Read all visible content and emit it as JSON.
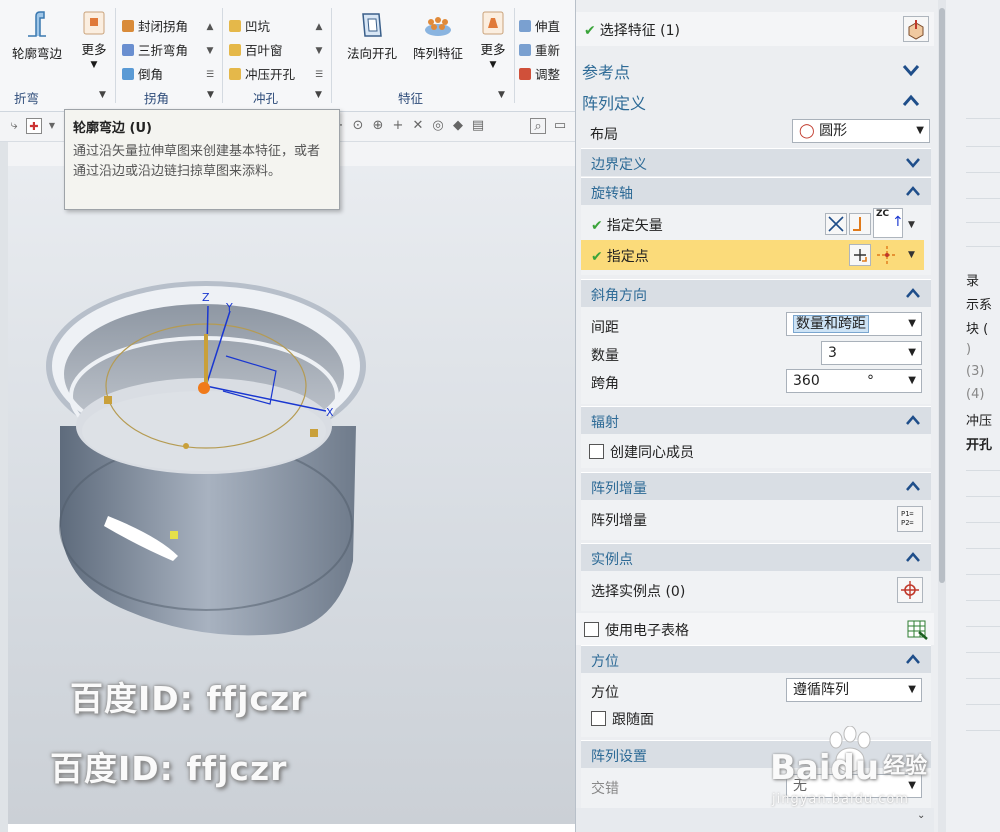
{
  "ribbon": {
    "big_buttons": [
      {
        "label": "轮廓弯边",
        "icon": "flange-icon"
      },
      {
        "label": "更多",
        "icon": "more-icon"
      },
      {
        "label": "法向开孔",
        "icon": "normal-cutout-icon"
      },
      {
        "label": "阵列特征",
        "icon": "pattern-feature-icon"
      },
      {
        "label": "更多",
        "icon": "more-icon"
      }
    ],
    "corner_items": [
      "封闭拐角",
      "三折弯角",
      "倒角"
    ],
    "punch_items": [
      "凹坑",
      "百叶窗",
      "冲压开孔"
    ],
    "right_items": [
      "伸直",
      "重新",
      "调整"
    ],
    "group_labels": {
      "bend": "折弯",
      "corner": "拐角",
      "punch": "冲孔",
      "feature": "特征"
    }
  },
  "tooltip": {
    "title": "轮廓弯边 (U)",
    "body": "通过沿矢量拉伸草图来创建基本特征，或者通过沿边或沿边链扫掠草图来添料。"
  },
  "watermarks": [
    "百度ID: ffjczr",
    "百度ID: ffjczr"
  ],
  "right_panel": {
    "labels": [
      "录",
      "示系",
      "块 (",
      ")",
      "(3)",
      "(4)",
      "冲压",
      "开孔"
    ]
  },
  "dialog": {
    "select_feature": "选择特征 (1)",
    "ref_point": "参考点",
    "pattern_def": "阵列定义",
    "layout_label": "布局",
    "layout_value": "圆形",
    "boundary_def": "边界定义",
    "rotation_axis": "旋转轴",
    "specify_vector": "指定矢量",
    "specify_point": "指定点",
    "vector_badge": "ZC",
    "angle_dir": "斜角方向",
    "spacing_label": "间距",
    "spacing_value": "数量和跨距",
    "count_label": "数量",
    "count_value": "3",
    "span_label": "跨角",
    "span_value": "360",
    "span_unit": "°",
    "radiate": "辐射",
    "create_concentric": "创建同心成员",
    "pattern_increment_head": "阵列增量",
    "pattern_increment": "阵列增量",
    "increment_badge": "P1= P2=",
    "instance_point_head": "实例点",
    "select_instance": "选择实例点 (0)",
    "use_spreadsheet": "使用电子表格",
    "orientation_head": "方位",
    "orientation_label": "方位",
    "orientation_value": "遵循阵列",
    "follow_face": "跟随面",
    "pattern_settings": "阵列设置",
    "stagger_label": "交错",
    "stagger_value": "无"
  },
  "baidu_logo": {
    "brand": "Bai",
    "brand2": "du",
    "suffix": "经验",
    "url": "jingyan.baidu.com"
  }
}
